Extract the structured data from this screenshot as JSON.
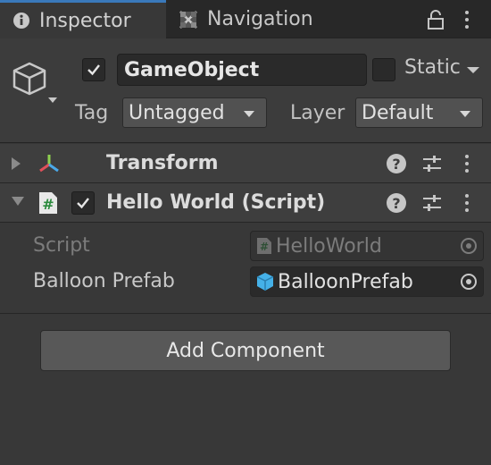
{
  "tabs": [
    {
      "label": "Inspector",
      "icon": "info-icon",
      "active": true
    },
    {
      "label": "Navigation",
      "icon": "navigation-icon",
      "active": false
    }
  ],
  "header": {
    "icon": "gameobject-cube-icon",
    "active_checked": true,
    "name": "GameObject",
    "static_label": "Static",
    "static_checked": false,
    "tag_label": "Tag",
    "tag_value": "Untagged",
    "layer_label": "Layer",
    "layer_value": "Default"
  },
  "components": [
    {
      "title": "Transform",
      "icon": "transform-icon",
      "expanded": false
    },
    {
      "title": "Hello World (Script)",
      "icon": "csharp-script-icon",
      "expanded": true,
      "enabled": true
    }
  ],
  "properties": [
    {
      "label": "Script",
      "value": "HelloWorld",
      "icon": "csharp-script-icon",
      "disabled": true
    },
    {
      "label": "Balloon Prefab",
      "value": "BalloonPrefab",
      "icon": "prefab-cube-icon",
      "disabled": false
    }
  ],
  "add_component_label": "Add Component",
  "colors": {
    "accent": "#3a79bb",
    "prefab_icon": "#45b1e8",
    "transform_y": "#8fd14f",
    "transform_x": "#e0505a",
    "transform_z": "#4aa8e8"
  }
}
